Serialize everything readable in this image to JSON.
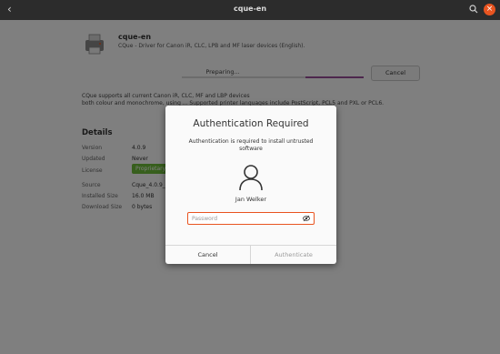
{
  "window": {
    "title": "cque-en"
  },
  "app": {
    "name": "cque-en",
    "description": "CQue - Driver for Canon iR, CLC, LPB and MF laser devices (English).",
    "progress_label": "Preparing...",
    "progress": 0.32,
    "cancel_label": "Cancel",
    "long_description_line1": "CQue supports all current Canon iR, CLC, MF and LBP devices",
    "long_description_line2": " both colour and monochrome, using ... Supported printer languages include PostScript, PCL5 and PXL or PCL6."
  },
  "details": {
    "title": "Details",
    "rows": [
      {
        "label": "Version",
        "value": "4.0.9"
      },
      {
        "label": "Updated",
        "value": "Never"
      },
      {
        "label": "License",
        "value": "Proprietary"
      },
      {
        "label": "Source",
        "value": "Cque_4.0.9_..."
      },
      {
        "label": "Installed Size",
        "value": "16.0 MB"
      },
      {
        "label": "Download Size",
        "value": "0 bytes"
      }
    ]
  },
  "dialog": {
    "title": "Authentication Required",
    "message": "Authentication is required to install untrusted software",
    "user_name": "Jan Welker",
    "password_placeholder": "Password",
    "cancel_label": "Cancel",
    "authenticate_label": "Authenticate"
  },
  "colors": {
    "accent": "#e95420",
    "progress": "#9a4f9a",
    "license_badge": "#6fbf3b",
    "titlebar": "#2c2c2c"
  },
  "icons": {
    "back": "chevron-left-icon",
    "search": "search-icon",
    "close": "close-icon",
    "avatar": "user-avatar-icon",
    "password_reveal": "eye-icon"
  }
}
